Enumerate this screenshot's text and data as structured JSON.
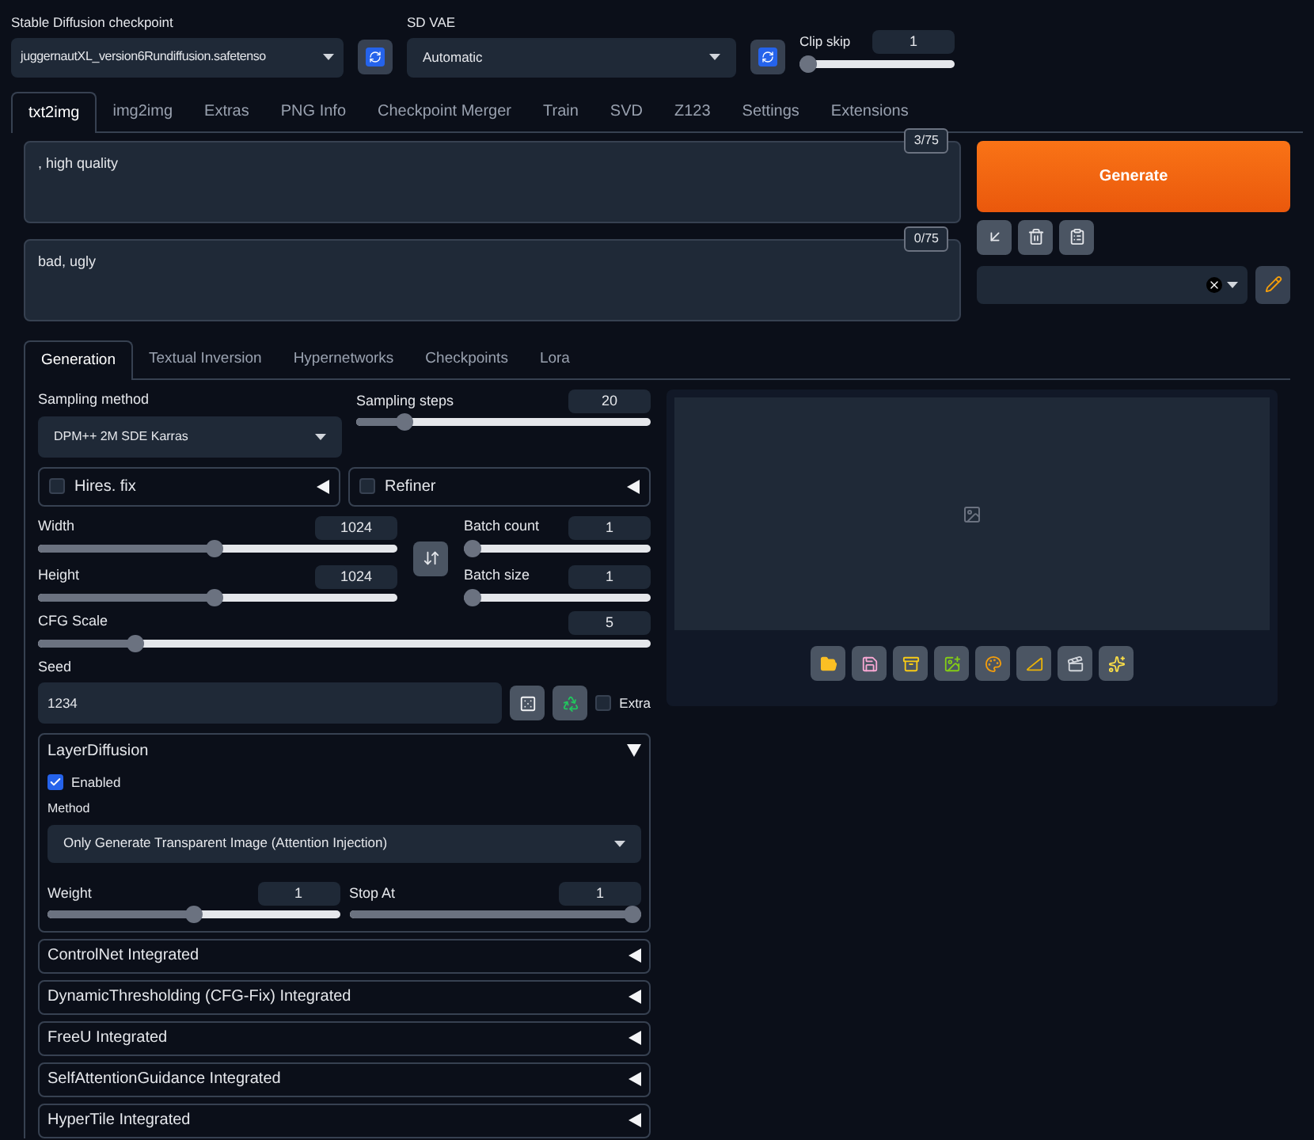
{
  "top": {
    "checkpoint": {
      "label": "Stable Diffusion checkpoint",
      "value": "juggernautXL_version6Rundiffusion.safetenso"
    },
    "vae": {
      "label": "SD VAE",
      "value": "Automatic"
    },
    "clip_skip": {
      "label": "Clip skip",
      "value": "1",
      "level": 0
    }
  },
  "tabs": [
    {
      "label": "txt2img",
      "selected": true
    },
    {
      "label": "img2img",
      "selected": false
    },
    {
      "label": "Extras",
      "selected": false
    },
    {
      "label": "PNG Info",
      "selected": false
    },
    {
      "label": "Checkpoint Merger",
      "selected": false
    },
    {
      "label": "Train",
      "selected": false
    },
    {
      "label": "SVD",
      "selected": false
    },
    {
      "label": "Z123",
      "selected": false
    },
    {
      "label": "Settings",
      "selected": false
    },
    {
      "label": "Extensions",
      "selected": false
    }
  ],
  "prompt": {
    "value": ", high quality",
    "counter": "3/75"
  },
  "negative_prompt": {
    "value": "bad, ugly",
    "counter": "0/75"
  },
  "generate_button": "Generate",
  "subtabs": [
    {
      "label": "Generation",
      "selected": true
    },
    {
      "label": "Textual Inversion",
      "selected": false
    },
    {
      "label": "Hypernetworks",
      "selected": false
    },
    {
      "label": "Checkpoints",
      "selected": false
    },
    {
      "label": "Lora",
      "selected": false
    }
  ],
  "generation": {
    "sampling_method": {
      "label": "Sampling method",
      "value": "DPM++ 2M SDE Karras"
    },
    "sampling_steps": {
      "label": "Sampling steps",
      "value": "20",
      "level": 0.14
    },
    "hires_fix": {
      "label": "Hires. fix",
      "checked": false,
      "expanded": false
    },
    "refiner": {
      "label": "Refiner",
      "checked": false,
      "expanded": false
    },
    "width": {
      "label": "Width",
      "value": "1024",
      "level": 0.49
    },
    "height": {
      "label": "Height",
      "value": "1024",
      "level": 0.49
    },
    "batch_count": {
      "label": "Batch count",
      "value": "1",
      "level": 0
    },
    "batch_size": {
      "label": "Batch size",
      "value": "1",
      "level": 0
    },
    "cfg_scale": {
      "label": "CFG Scale",
      "value": "5",
      "level": 0.15
    },
    "seed": {
      "label": "Seed",
      "value": "1234"
    },
    "extra": {
      "label": "Extra",
      "checked": false
    }
  },
  "accordions": [
    {
      "title": "LayerDiffusion",
      "expanded": true,
      "enabled": {
        "label": "Enabled",
        "checked": true
      },
      "method": {
        "label": "Method",
        "value": "Only Generate Transparent Image (Attention Injection)"
      },
      "weight": {
        "label": "Weight",
        "value": "1",
        "level": 0.5
      },
      "stop_at": {
        "label": "Stop At",
        "value": "1",
        "level": 1
      }
    },
    {
      "title": "ControlNet Integrated",
      "expanded": false
    },
    {
      "title": "DynamicThresholding (CFG-Fix) Integrated",
      "expanded": false
    },
    {
      "title": "FreeU Integrated",
      "expanded": false
    },
    {
      "title": "SelfAttentionGuidance Integrated",
      "expanded": false
    },
    {
      "title": "HyperTile Integrated",
      "expanded": false
    }
  ]
}
